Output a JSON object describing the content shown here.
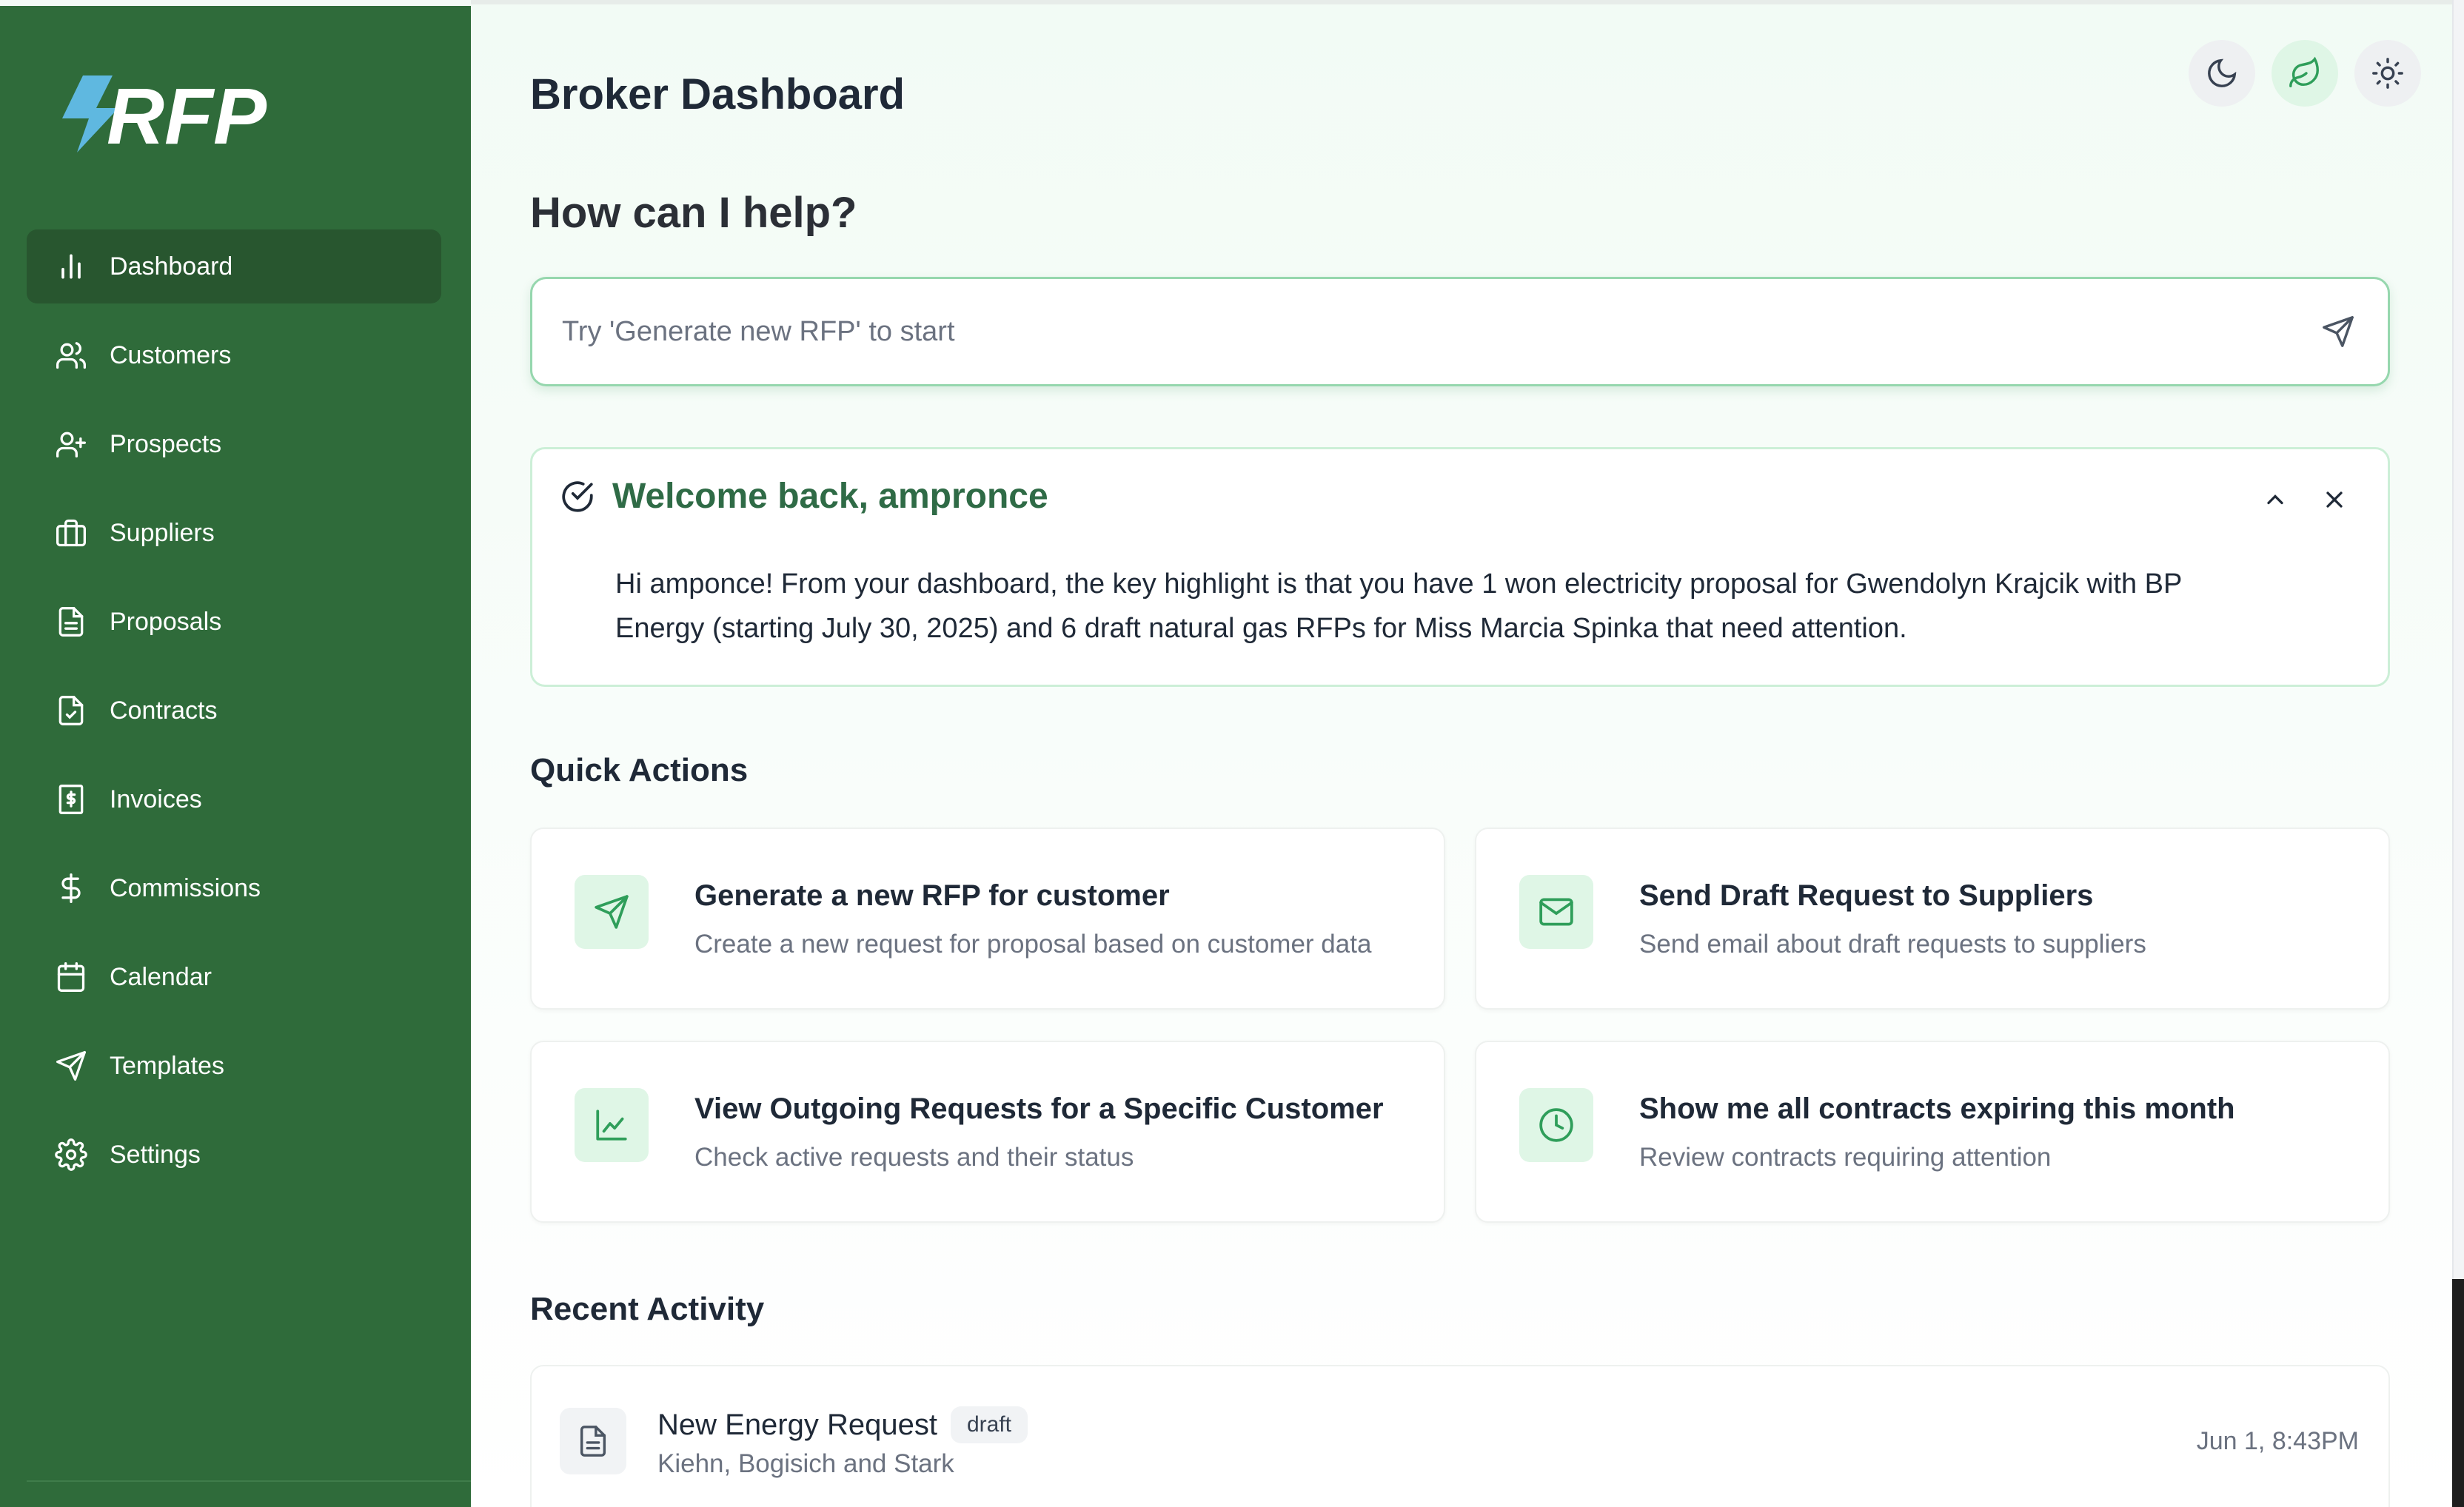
{
  "brand": {
    "logo_text": "RFP"
  },
  "sidebar": {
    "items": [
      {
        "label": "Dashboard",
        "icon": "bar-chart-icon"
      },
      {
        "label": "Customers",
        "icon": "users-icon"
      },
      {
        "label": "Prospects",
        "icon": "user-plus-icon"
      },
      {
        "label": "Suppliers",
        "icon": "briefcase-icon"
      },
      {
        "label": "Proposals",
        "icon": "file-text-icon"
      },
      {
        "label": "Contracts",
        "icon": "file-check-icon"
      },
      {
        "label": "Invoices",
        "icon": "receipt-dollar-icon"
      },
      {
        "label": "Commissions",
        "icon": "dollar-icon"
      },
      {
        "label": "Calendar",
        "icon": "calendar-icon"
      },
      {
        "label": "Templates",
        "icon": "send-icon"
      },
      {
        "label": "Settings",
        "icon": "gear-icon"
      }
    ],
    "active": "Dashboard"
  },
  "header": {
    "title": "Broker Dashboard",
    "theme_buttons": [
      "moon-icon",
      "leaf-icon",
      "sun-icon"
    ]
  },
  "assistant": {
    "heading": "How can I help?",
    "placeholder": "Try 'Generate new RFP' to start"
  },
  "welcome": {
    "title": "Welcome back, ampronce",
    "body": "Hi amponce! From your dashboard, the key highlight is that you have 1 won electricity proposal for Gwendolyn Krajcik with BP Energy (starting July 30, 2025) and 6 draft natural gas RFPs for Miss Marcia Spinka that need attention."
  },
  "quick_actions": {
    "title": "Quick Actions",
    "items": [
      {
        "title": "Generate a new RFP for customer",
        "description": "Create a new request for proposal based on customer data",
        "icon": "send-icon"
      },
      {
        "title": "Send Draft Request to Suppliers",
        "description": "Send email about draft requests to suppliers",
        "icon": "mail-icon"
      },
      {
        "title": "View Outgoing Requests for a Specific Customer",
        "description": "Check active requests and their status",
        "icon": "line-chart-icon"
      },
      {
        "title": "Show me all contracts expiring this month",
        "description": "Review contracts requiring attention",
        "icon": "clock-icon"
      }
    ]
  },
  "recent_activity": {
    "title": "Recent Activity",
    "items": [
      {
        "title": "New Energy Request",
        "status": "draft",
        "subtitle": "Kiehn, Bogisich and Stark",
        "time": "Jun 1, 8:43PM"
      }
    ]
  },
  "colors": {
    "sidebar": "#2f6b3a",
    "sidebar_active": "#28562f",
    "accent": "#2f9e5a",
    "logo_accent": "#5fb8e0"
  }
}
